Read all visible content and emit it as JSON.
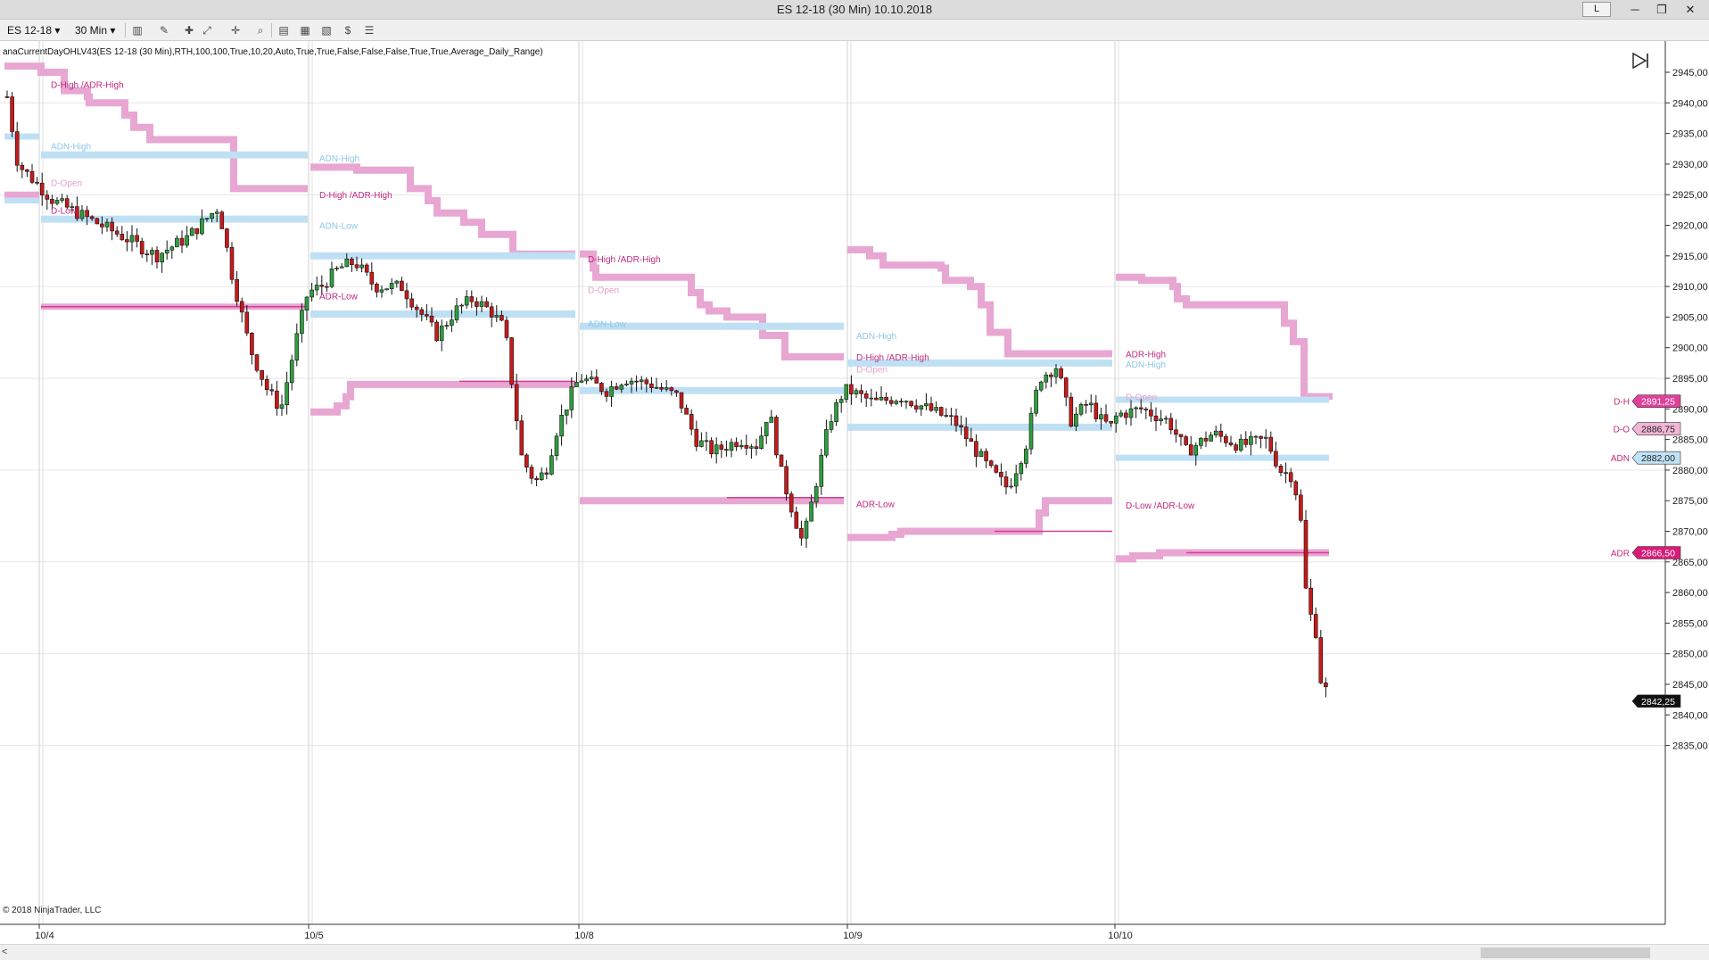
{
  "window": {
    "title": "ES 12-18 (30 Min)  10.10.2018",
    "link_button": "L"
  },
  "toolbar": {
    "instrument": "ES 12-18",
    "interval": "30 Min"
  },
  "chart": {
    "indicator_label": "anaCurrentDayOHLV43(ES 12-18 (30 Min),RTH,100,100,True,10,20,Auto,True,True,False,False,False,True,True,Average_Daily_Range)",
    "copyright": "© 2018 NinjaTrader, LLC",
    "price_ticks": [
      "2945,00",
      "2940,00",
      "2935,00",
      "2930,00",
      "2925,00",
      "2920,00",
      "2915,00",
      "2910,00",
      "2905,00",
      "2900,00",
      "2895,00",
      "2890,00",
      "2885,00",
      "2880,00",
      "2875,00",
      "2870,00",
      "2865,00",
      "2860,00",
      "2855,00",
      "2850,00",
      "2845,00",
      "2840,00",
      "2835,00"
    ],
    "date_ticks": [
      "10/4",
      "10/5",
      "10/8",
      "10/9",
      "10/10"
    ],
    "line_labels": [
      {
        "text": "D-High /ADR-High",
        "kind": "d"
      },
      {
        "text": "ADN-High",
        "kind": "a"
      },
      {
        "text": "D-Open",
        "kind": "o"
      },
      {
        "text": "D-Low",
        "kind": "d"
      },
      {
        "text": "ADN-High",
        "kind": "a"
      },
      {
        "text": "D-High /ADR-High",
        "kind": "d"
      },
      {
        "text": "ADN-Low",
        "kind": "a"
      },
      {
        "text": "ADR-Low",
        "kind": "d"
      },
      {
        "text": "D-High /ADR-High",
        "kind": "d"
      },
      {
        "text": "D-Open",
        "kind": "o"
      },
      {
        "text": "ADN-Low",
        "kind": "a"
      },
      {
        "text": "ADN-High",
        "kind": "a"
      },
      {
        "text": "D-High /ADR-High",
        "kind": "d"
      },
      {
        "text": "D-Open",
        "kind": "o"
      },
      {
        "text": "ADR-Low",
        "kind": "d"
      },
      {
        "text": "ADR-High",
        "kind": "d"
      },
      {
        "text": "ADN-High",
        "kind": "a"
      },
      {
        "text": "D-Open",
        "kind": "o"
      },
      {
        "text": "D-Low /ADR-Low",
        "kind": "d"
      }
    ],
    "price_markers": [
      {
        "text": "2891,25",
        "price": 2891.25,
        "color": "#e0409a",
        "label": "D-H"
      },
      {
        "text": "2886,75",
        "price": 2886.75,
        "color": "#f2b6d6",
        "label": "D-O"
      },
      {
        "text": "2882,00",
        "price": 2882.0,
        "color": "#bfe2f5",
        "label": "ADN"
      },
      {
        "text": "2866,50",
        "price": 2866.5,
        "color": "#d81b78",
        "label": "ADR"
      },
      {
        "text": "2842,25",
        "price": 2842.25,
        "color": "#111111",
        "label": ""
      }
    ]
  }
}
